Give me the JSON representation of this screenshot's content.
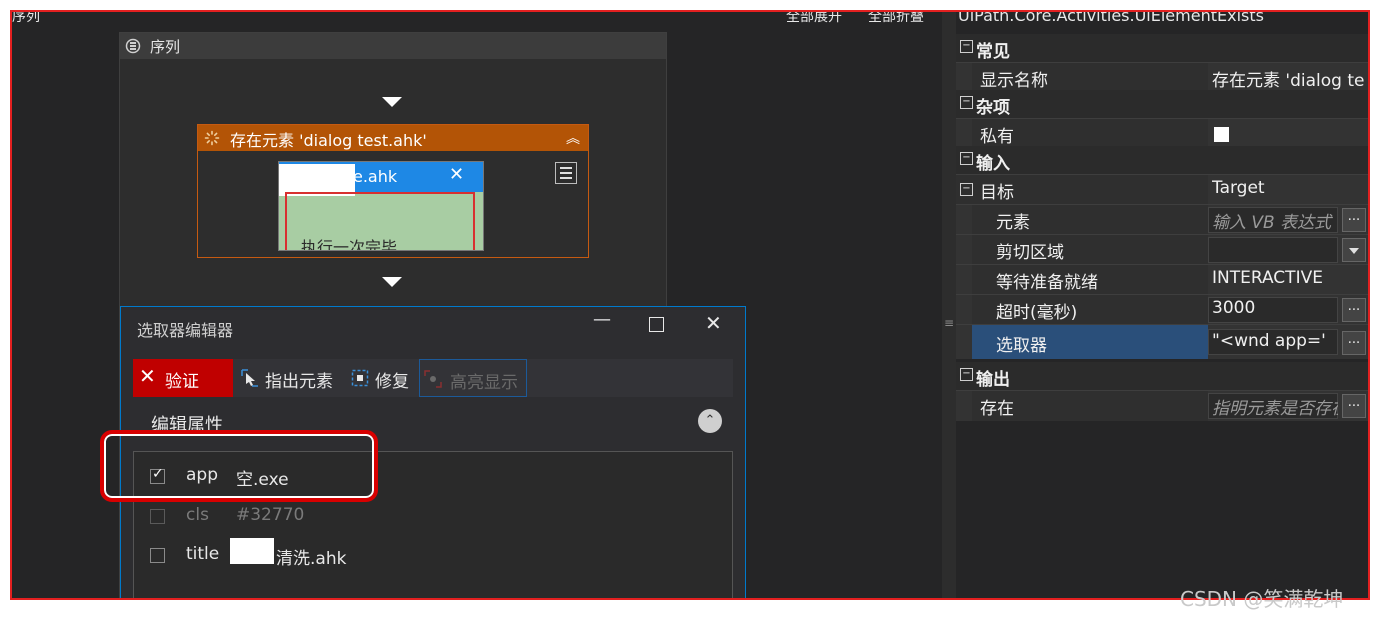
{
  "designer": {
    "title": "序列",
    "expand_all": "全部展开",
    "collapse_all": "全部折叠"
  },
  "sequence": {
    "title": "序列"
  },
  "activity": {
    "title": "存在元素 'dialog  test.ahk'",
    "collapse_icon": "double-chevron-up-icon",
    "thumbnail": {
      "window_title": "e.ahk",
      "close_glyph": "✕",
      "body_text": "执行一次完毕"
    }
  },
  "selector_editor": {
    "title": "选取器编辑器",
    "min_glyph": "—",
    "close_glyph": "✕",
    "toolbar": {
      "validate": "验证",
      "indicate": "指出元素",
      "repair": "修复",
      "highlight": "高亮显示"
    },
    "edit_attributes": "编辑属性",
    "collapse_glyph": "⌃",
    "attributes": [
      {
        "name": "app",
        "value": "空.exe",
        "checked": true
      },
      {
        "name": "cls",
        "value": "#32770",
        "checked": false
      },
      {
        "name": "title",
        "value": "清洗.ahk",
        "checked": false
      }
    ]
  },
  "properties": {
    "header": "UiPath.Core.Activities.UiElementExists",
    "categories": {
      "common": "常见",
      "misc": "杂项",
      "input": "输入",
      "output": "输出"
    },
    "rows": {
      "display_name": {
        "label": "显示名称",
        "value": "存在元素 'dialog  te"
      },
      "private": {
        "label": "私有"
      },
      "target": {
        "label": "目标",
        "value": "Target"
      },
      "element": {
        "label": "元素",
        "placeholder": "输入 VB 表达式"
      },
      "clipping_region": {
        "label": "剪切区域"
      },
      "wait_for_ready": {
        "label": "等待准备就绪",
        "value": "INTERACTIVE"
      },
      "timeout": {
        "label": "超时(毫秒)",
        "value": "3000"
      },
      "selector": {
        "label": "选取器",
        "value": "\"<wnd app='"
      },
      "exists": {
        "label": "存在",
        "placeholder": "指明元素是否存在"
      }
    },
    "toggle_glyph": "−",
    "ellipsis": "..."
  },
  "watermark": "CSDN @笑满乾坤"
}
